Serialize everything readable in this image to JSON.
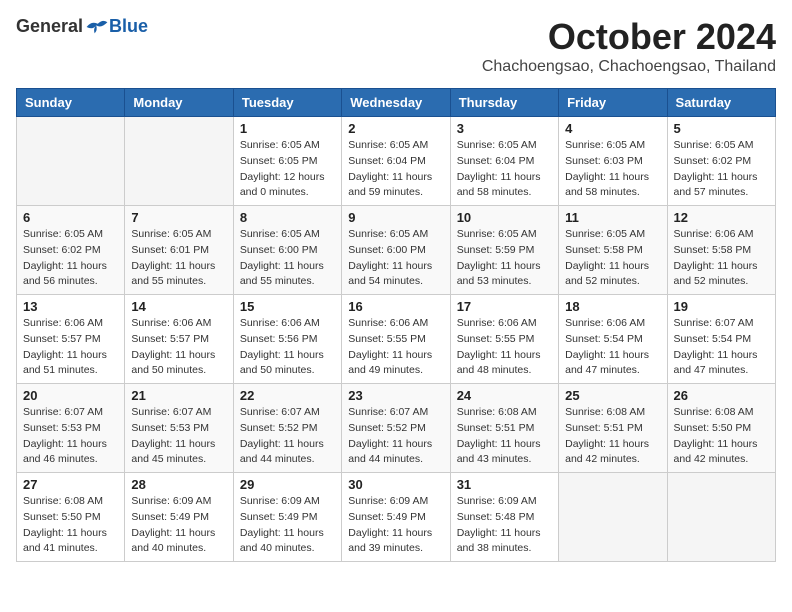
{
  "logo": {
    "general": "General",
    "blue": "Blue"
  },
  "header": {
    "month": "October 2024",
    "subtitle": "Chachoengsao, Chachoengsao, Thailand"
  },
  "weekdays": [
    "Sunday",
    "Monday",
    "Tuesday",
    "Wednesday",
    "Thursday",
    "Friday",
    "Saturday"
  ],
  "weeks": [
    [
      {
        "day": "",
        "info": ""
      },
      {
        "day": "",
        "info": ""
      },
      {
        "day": "1",
        "info": "Sunrise: 6:05 AM\nSunset: 6:05 PM\nDaylight: 12 hours\nand 0 minutes."
      },
      {
        "day": "2",
        "info": "Sunrise: 6:05 AM\nSunset: 6:04 PM\nDaylight: 11 hours\nand 59 minutes."
      },
      {
        "day": "3",
        "info": "Sunrise: 6:05 AM\nSunset: 6:04 PM\nDaylight: 11 hours\nand 58 minutes."
      },
      {
        "day": "4",
        "info": "Sunrise: 6:05 AM\nSunset: 6:03 PM\nDaylight: 11 hours\nand 58 minutes."
      },
      {
        "day": "5",
        "info": "Sunrise: 6:05 AM\nSunset: 6:02 PM\nDaylight: 11 hours\nand 57 minutes."
      }
    ],
    [
      {
        "day": "6",
        "info": "Sunrise: 6:05 AM\nSunset: 6:02 PM\nDaylight: 11 hours\nand 56 minutes."
      },
      {
        "day": "7",
        "info": "Sunrise: 6:05 AM\nSunset: 6:01 PM\nDaylight: 11 hours\nand 55 minutes."
      },
      {
        "day": "8",
        "info": "Sunrise: 6:05 AM\nSunset: 6:00 PM\nDaylight: 11 hours\nand 55 minutes."
      },
      {
        "day": "9",
        "info": "Sunrise: 6:05 AM\nSunset: 6:00 PM\nDaylight: 11 hours\nand 54 minutes."
      },
      {
        "day": "10",
        "info": "Sunrise: 6:05 AM\nSunset: 5:59 PM\nDaylight: 11 hours\nand 53 minutes."
      },
      {
        "day": "11",
        "info": "Sunrise: 6:05 AM\nSunset: 5:58 PM\nDaylight: 11 hours\nand 52 minutes."
      },
      {
        "day": "12",
        "info": "Sunrise: 6:06 AM\nSunset: 5:58 PM\nDaylight: 11 hours\nand 52 minutes."
      }
    ],
    [
      {
        "day": "13",
        "info": "Sunrise: 6:06 AM\nSunset: 5:57 PM\nDaylight: 11 hours\nand 51 minutes."
      },
      {
        "day": "14",
        "info": "Sunrise: 6:06 AM\nSunset: 5:57 PM\nDaylight: 11 hours\nand 50 minutes."
      },
      {
        "day": "15",
        "info": "Sunrise: 6:06 AM\nSunset: 5:56 PM\nDaylight: 11 hours\nand 50 minutes."
      },
      {
        "day": "16",
        "info": "Sunrise: 6:06 AM\nSunset: 5:55 PM\nDaylight: 11 hours\nand 49 minutes."
      },
      {
        "day": "17",
        "info": "Sunrise: 6:06 AM\nSunset: 5:55 PM\nDaylight: 11 hours\nand 48 minutes."
      },
      {
        "day": "18",
        "info": "Sunrise: 6:06 AM\nSunset: 5:54 PM\nDaylight: 11 hours\nand 47 minutes."
      },
      {
        "day": "19",
        "info": "Sunrise: 6:07 AM\nSunset: 5:54 PM\nDaylight: 11 hours\nand 47 minutes."
      }
    ],
    [
      {
        "day": "20",
        "info": "Sunrise: 6:07 AM\nSunset: 5:53 PM\nDaylight: 11 hours\nand 46 minutes."
      },
      {
        "day": "21",
        "info": "Sunrise: 6:07 AM\nSunset: 5:53 PM\nDaylight: 11 hours\nand 45 minutes."
      },
      {
        "day": "22",
        "info": "Sunrise: 6:07 AM\nSunset: 5:52 PM\nDaylight: 11 hours\nand 44 minutes."
      },
      {
        "day": "23",
        "info": "Sunrise: 6:07 AM\nSunset: 5:52 PM\nDaylight: 11 hours\nand 44 minutes."
      },
      {
        "day": "24",
        "info": "Sunrise: 6:08 AM\nSunset: 5:51 PM\nDaylight: 11 hours\nand 43 minutes."
      },
      {
        "day": "25",
        "info": "Sunrise: 6:08 AM\nSunset: 5:51 PM\nDaylight: 11 hours\nand 42 minutes."
      },
      {
        "day": "26",
        "info": "Sunrise: 6:08 AM\nSunset: 5:50 PM\nDaylight: 11 hours\nand 42 minutes."
      }
    ],
    [
      {
        "day": "27",
        "info": "Sunrise: 6:08 AM\nSunset: 5:50 PM\nDaylight: 11 hours\nand 41 minutes."
      },
      {
        "day": "28",
        "info": "Sunrise: 6:09 AM\nSunset: 5:49 PM\nDaylight: 11 hours\nand 40 minutes."
      },
      {
        "day": "29",
        "info": "Sunrise: 6:09 AM\nSunset: 5:49 PM\nDaylight: 11 hours\nand 40 minutes."
      },
      {
        "day": "30",
        "info": "Sunrise: 6:09 AM\nSunset: 5:49 PM\nDaylight: 11 hours\nand 39 minutes."
      },
      {
        "day": "31",
        "info": "Sunrise: 6:09 AM\nSunset: 5:48 PM\nDaylight: 11 hours\nand 38 minutes."
      },
      {
        "day": "",
        "info": ""
      },
      {
        "day": "",
        "info": ""
      }
    ]
  ]
}
